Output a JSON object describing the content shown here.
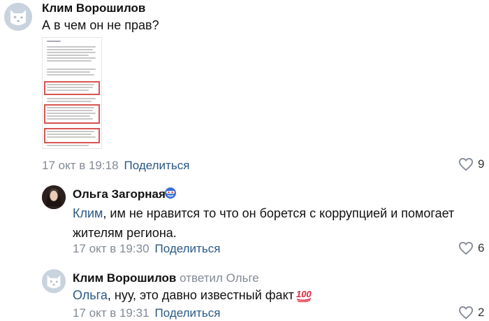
{
  "comments": [
    {
      "author": "Клим Ворошилов",
      "text": "А в чем он не прав?",
      "time": "17 окт в 19:18",
      "share": "Поделиться",
      "likes": "9"
    },
    {
      "author": "Ольга Загорная",
      "mention": "Клим",
      "text_line1": ", им не нравится то что он борется с коррупцией и помогает",
      "text_line2": "жителям региона.",
      "time": "17 окт в 19:30",
      "share": "Поделиться",
      "likes": "6"
    },
    {
      "author": "Клим Ворошилов",
      "replied": "ответил Ольге",
      "mention": "Ольга",
      "text": ", нуу, это давно известный факт",
      "time": "17 окт в 19:31",
      "share": "Поделиться",
      "likes": "2"
    }
  ],
  "icons": {
    "like": "heart-outline-icon",
    "default_avatar": "vk-dog-avatar",
    "badge": "mask-emoji-badge",
    "hundred": "hundred-points-emoji"
  },
  "colors": {
    "link": "#2a5885",
    "meta": "#828a94",
    "highlight_border": "#d9534f"
  }
}
